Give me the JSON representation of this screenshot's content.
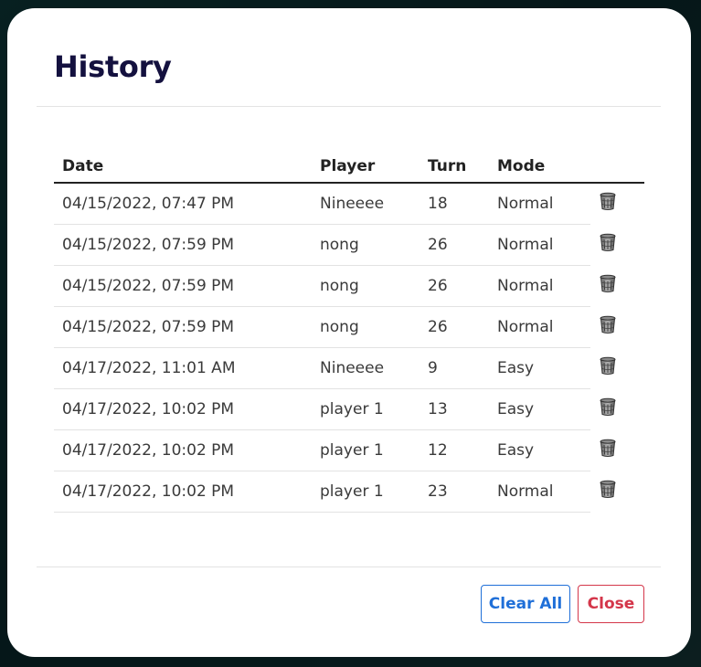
{
  "dialog": {
    "title": "History"
  },
  "table": {
    "headers": {
      "date": "Date",
      "player": "Player",
      "turn": "Turn",
      "mode": "Mode"
    },
    "rows": [
      {
        "date": "04/15/2022, 07:47 PM",
        "player": "Nineeee",
        "turn": "18",
        "mode": "Normal"
      },
      {
        "date": "04/15/2022, 07:59 PM",
        "player": "nong",
        "turn": "26",
        "mode": "Normal"
      },
      {
        "date": "04/15/2022, 07:59 PM",
        "player": "nong",
        "turn": "26",
        "mode": "Normal"
      },
      {
        "date": "04/15/2022, 07:59 PM",
        "player": "nong",
        "turn": "26",
        "mode": "Normal"
      },
      {
        "date": "04/17/2022, 11:01 AM",
        "player": "Nineeee",
        "turn": "9",
        "mode": "Easy"
      },
      {
        "date": "04/17/2022, 10:02 PM",
        "player": "player 1",
        "turn": "13",
        "mode": "Easy"
      },
      {
        "date": "04/17/2022, 10:02 PM",
        "player": "player 1",
        "turn": "12",
        "mode": "Easy"
      },
      {
        "date": "04/17/2022, 10:02 PM",
        "player": "player 1",
        "turn": "23",
        "mode": "Normal"
      }
    ],
    "row_action_icon": "trash-icon"
  },
  "footer": {
    "clear_all_label": "Clear All",
    "close_label": "Close"
  },
  "colors": {
    "title": "#14113f",
    "clear_all": "#1f6fd8",
    "close": "#d4364a"
  }
}
